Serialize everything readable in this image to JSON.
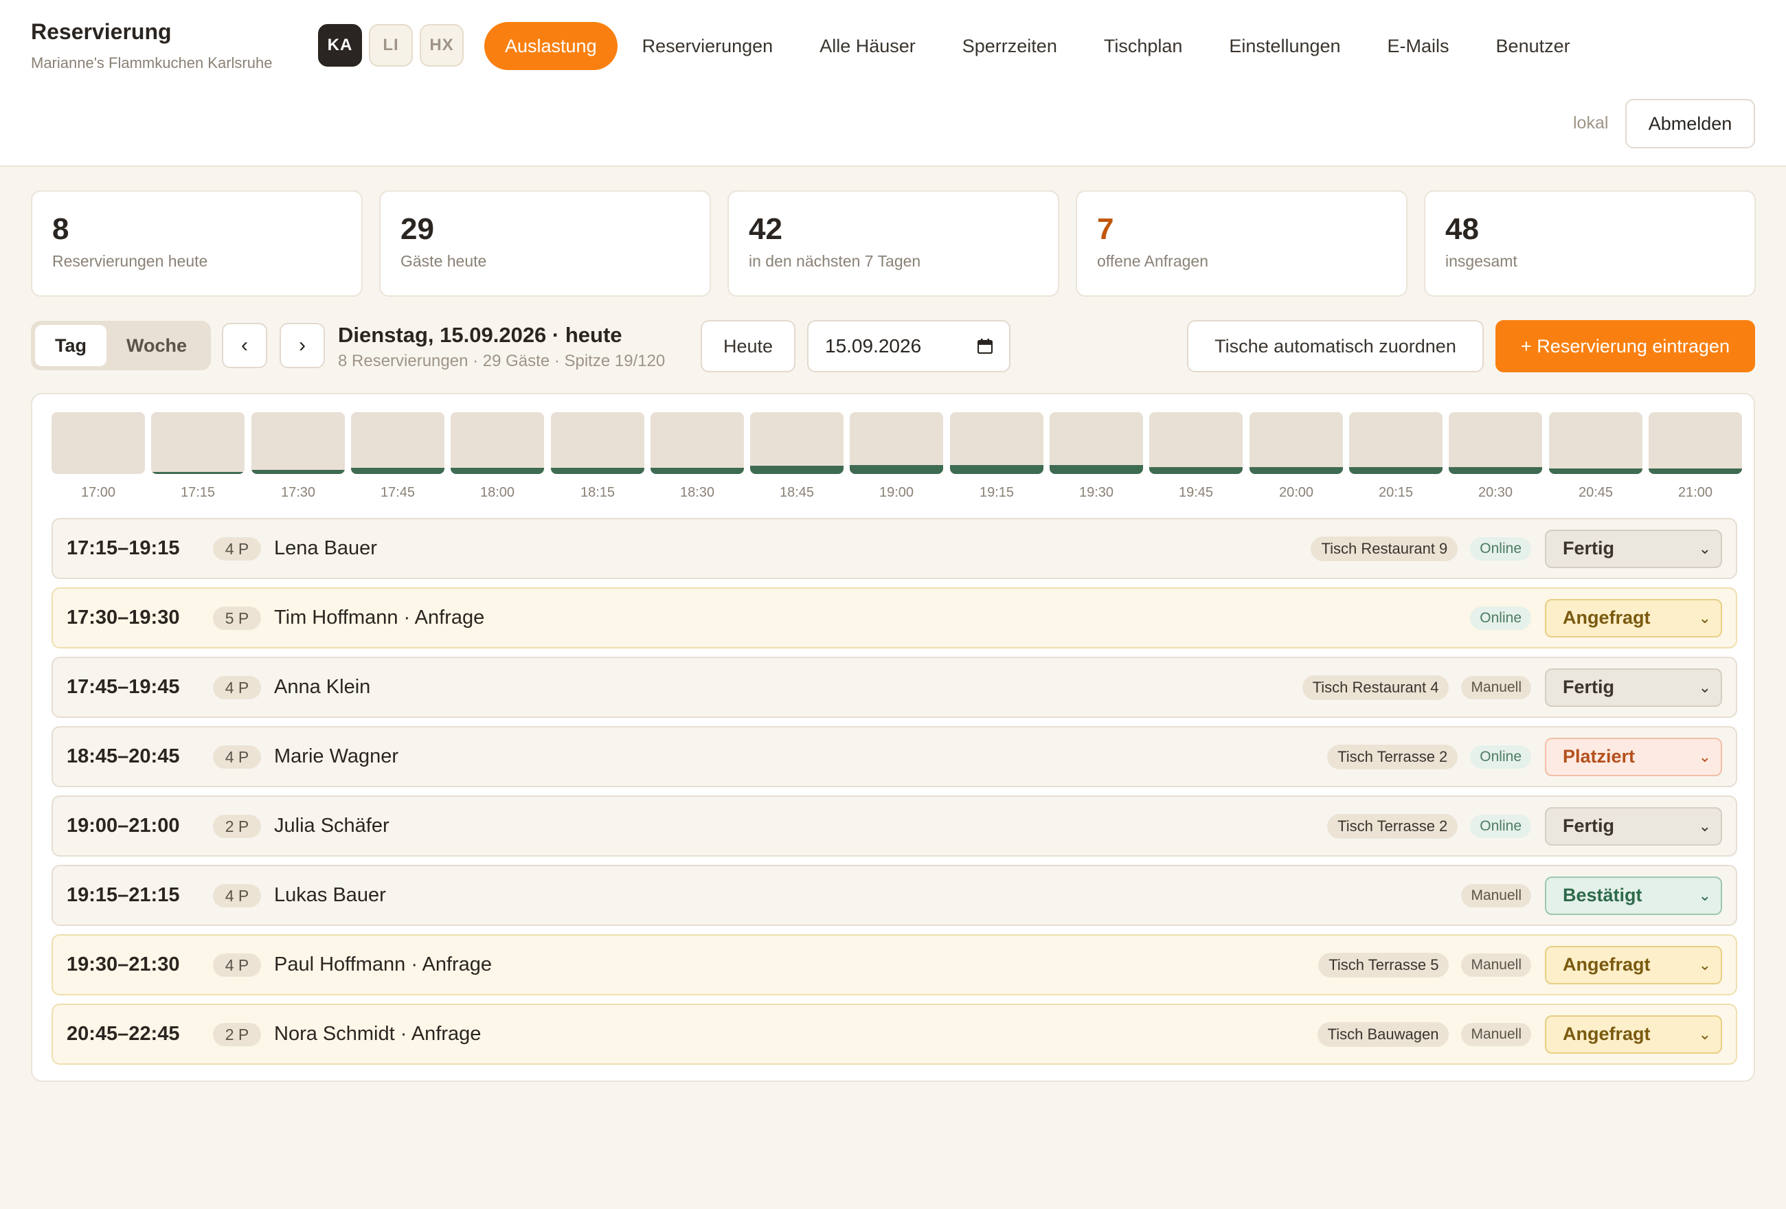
{
  "app": {
    "title": "Reservierung",
    "subtitle": "Marianne's Flammkuchen Karlsruhe"
  },
  "houses": [
    {
      "code": "KA",
      "active": true
    },
    {
      "code": "LI",
      "active": false
    },
    {
      "code": "HX",
      "active": false
    }
  ],
  "nav": {
    "items": [
      {
        "label": "Auslastung",
        "active": true
      },
      {
        "label": "Reservierungen",
        "active": false
      },
      {
        "label": "Alle Häuser",
        "active": false
      },
      {
        "label": "Sperrzeiten",
        "active": false
      },
      {
        "label": "Tischplan",
        "active": false
      },
      {
        "label": "Einstellungen",
        "active": false
      },
      {
        "label": "E-Mails",
        "active": false
      },
      {
        "label": "Benutzer",
        "active": false
      }
    ],
    "mode_label": "lokal",
    "logout_label": "Abmelden"
  },
  "stats": [
    {
      "value": "8",
      "label": "Reservierungen heute",
      "accent": false
    },
    {
      "value": "29",
      "label": "Gäste heute",
      "accent": false
    },
    {
      "value": "42",
      "label": "in den nächsten 7 Tagen",
      "accent": false
    },
    {
      "value": "7",
      "label": "offene Anfragen",
      "accent": true
    },
    {
      "value": "48",
      "label": "insgesamt",
      "accent": false
    }
  ],
  "toolbar": {
    "view_day": "Tag",
    "view_week": "Woche",
    "prev_label": "‹",
    "next_label": "›",
    "date_title": "Dienstag, 15.09.2026 · heute",
    "date_summary": "8 Reservierungen · 29 Gäste · Spitze 19/120",
    "today_label": "Heute",
    "date_value": "15.09.2026",
    "auto_assign_label": "Tische automatisch zuordnen",
    "add_label": "+ Reservierung eintragen"
  },
  "timeline": {
    "slots": [
      {
        "time": "17:00",
        "load": 0
      },
      {
        "time": "17:15",
        "load": 4
      },
      {
        "time": "17:30",
        "load": 9
      },
      {
        "time": "17:45",
        "load": 13
      },
      {
        "time": "18:00",
        "load": 13
      },
      {
        "time": "18:15",
        "load": 13
      },
      {
        "time": "18:30",
        "load": 13
      },
      {
        "time": "18:45",
        "load": 17
      },
      {
        "time": "19:00",
        "load": 19
      },
      {
        "time": "19:15",
        "load": 19
      },
      {
        "time": "19:30",
        "load": 19
      },
      {
        "time": "19:45",
        "load": 15
      },
      {
        "time": "20:00",
        "load": 15
      },
      {
        "time": "20:15",
        "load": 15
      },
      {
        "time": "20:30",
        "load": 15
      },
      {
        "time": "20:45",
        "load": 12
      },
      {
        "time": "21:00",
        "load": 12
      }
    ],
    "capacity": 120,
    "bar_color": "#3e6b52"
  },
  "reservations": [
    {
      "time": "17:15–19:15",
      "persons": "4 P",
      "name": "Lena Bauer",
      "table": "Tisch Restaurant 9",
      "source": "Online",
      "status": "Fertig",
      "request": false
    },
    {
      "time": "17:30–19:30",
      "persons": "5 P",
      "name": "Tim Hoffmann · Anfrage",
      "table": "",
      "source": "Online",
      "status": "Angefragt",
      "request": true
    },
    {
      "time": "17:45–19:45",
      "persons": "4 P",
      "name": "Anna Klein",
      "table": "Tisch Restaurant 4",
      "source": "Manuell",
      "status": "Fertig",
      "request": false
    },
    {
      "time": "18:45–20:45",
      "persons": "4 P",
      "name": "Marie Wagner",
      "table": "Tisch Terrasse 2",
      "source": "Online",
      "status": "Platziert",
      "request": false
    },
    {
      "time": "19:00–21:00",
      "persons": "2 P",
      "name": "Julia Schäfer",
      "table": "Tisch Terrasse 2",
      "source": "Online",
      "status": "Fertig",
      "request": false
    },
    {
      "time": "19:15–21:15",
      "persons": "4 P",
      "name": "Lukas Bauer",
      "table": "",
      "source": "Manuell",
      "status": "Bestätigt",
      "request": false
    },
    {
      "time": "19:30–21:30",
      "persons": "4 P",
      "name": "Paul Hoffmann · Anfrage",
      "table": "Tisch Terrasse 5",
      "source": "Manuell",
      "status": "Angefragt",
      "request": true
    },
    {
      "time": "20:45–22:45",
      "persons": "2 P",
      "name": "Nora Schmidt · Anfrage",
      "table": "Tisch Bauwagen",
      "source": "Manuell",
      "status": "Angefragt",
      "request": true
    }
  ],
  "colors": {
    "accent": "#f98010",
    "background": "#f8f5ef",
    "dark": "#2a2520"
  }
}
